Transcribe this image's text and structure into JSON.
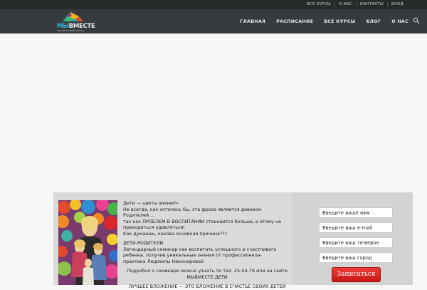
{
  "topbar": {
    "links": [
      "ВСЕ КУРСЫ",
      "О НАС",
      "КОНТАКТЫ",
      "ВХОД"
    ]
  },
  "header": {
    "logo": {
      "brand_prefix": "МЫ",
      "brand_main": "ВМЕСТЕ",
      "tagline": "тренинговый центр"
    },
    "nav": [
      "ГЛАВНАЯ",
      "РАСПИСАНИЕ",
      "ВСЕ КУРСЫ",
      "БЛОГ",
      "О НАС"
    ]
  },
  "promo": {
    "text": {
      "l1": "Дети — цветы жизни!»",
      "l2": "Не всегда, как хотелось бы, эта фраза является девизом Родителей....",
      "l3": "так как ПРОБЛЕМ В ВОСПИТАНИИ становится больше, и этому не",
      "l4": "приходиться удивляться!",
      "l5": "Как думаешь, какова основная причина???",
      "l6": "ДЕТИ-РОДИТЕЛИ",
      "l7": "Легендарный семинар как воспитать успешного и счастливого",
      "l8": "ребенка, получив уникальные знания от профессионала-",
      "l9": "практика Людмилы Никоноровой",
      "l10": "Подробно о семинаре можно узнать по тел. 25-54-76 или на сайте",
      "l11": "МЫВМЕСТЕ.ДЕТИ",
      "l12": "ЛУЧШЕЕ ВЛОЖЕНИЕ — ЭТО ВЛОЖЕНИЕ В СЧАСТЬЕ СВОИХ ДЕТЕЙ"
    },
    "form": {
      "name_placeholder": "Введите ваше имя",
      "email_placeholder": "Введите ваш e-mail",
      "phone_placeholder": "Введите ваш телефон",
      "city_placeholder": "Введите ваш город",
      "submit_label": "Записаться"
    }
  },
  "icons": {
    "search": "search-icon",
    "logo_roof": "house-roof-icon"
  },
  "colors": {
    "topbar": "#262a2b",
    "header": "#363c3e",
    "accent": "#34b0d4",
    "button": "#d92321"
  }
}
